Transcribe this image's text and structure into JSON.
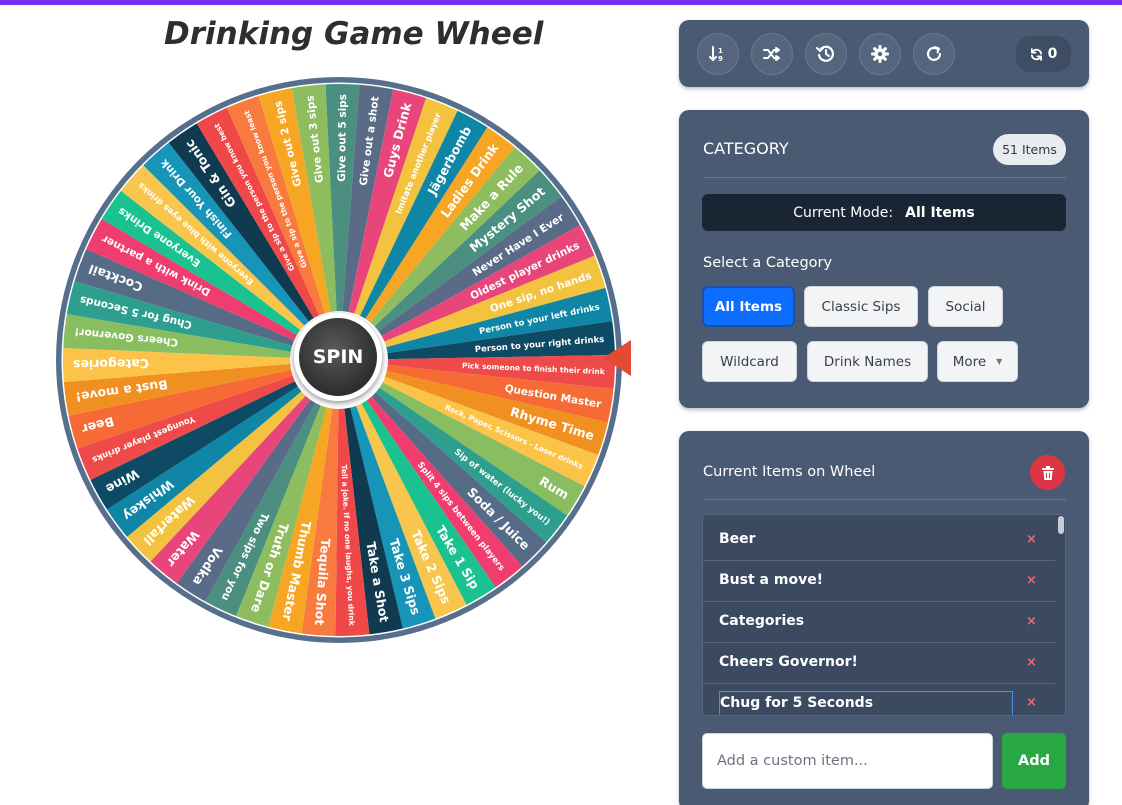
{
  "page": {
    "title": "Drinking Game Wheel"
  },
  "wheel": {
    "spin_label": "SPIN",
    "start_angle_deg": -57.5,
    "segments": [
      "Ladies Drink",
      "Make a Rule",
      "Mystery Shot",
      "Never Have I Ever",
      "Oldest player drinks",
      "One sip, no hands",
      "Person to your left drinks",
      "Person to your right drinks",
      "Pick someone to finish their drink",
      "Question Master",
      "Rhyme Time",
      "Rock, Paper, Scissors - Loser drinks",
      "Rum",
      "Sip of water (lucky you!)",
      "Soda / Juice",
      "Split 4 sips between players",
      "Take 1 Sip",
      "Take 2 Sips",
      "Take 3 Sips",
      "Take a Shot",
      "Tell a joke. If no one laughs, you drink",
      "Tequila Shot",
      "Thumb Master",
      "Truth or Dare",
      "Two sips for you",
      "Vodka",
      "Water",
      "Waterfall",
      "Whiskey",
      "Wine",
      "Youngest player drinks",
      "Beer",
      "Bust a move!",
      "Categories",
      "Cheers Governor!",
      "Chug for 5 Seconds",
      "Cocktail",
      "Drink with a partner",
      "Everyone Drinks",
      "Everyone with blue eyes drinks",
      "Finish Your Drink",
      "Gin & Tonic",
      "Give a sip to the person you know best",
      "Give a sip to the person you know least",
      "Give out 2 sips",
      "Give out 3 sips",
      "Give out 5 sips",
      "Give out a shot",
      "Guys Drink",
      "Imitate another player",
      "Jägerbomb"
    ],
    "palette": [
      "#f7a623",
      "#8ebd5f",
      "#4a8f7f",
      "#596b86",
      "#e8457a",
      "#f3c23e",
      "#0f86a6",
      "#0e4a63",
      "#ee4a4a",
      "#f56a35",
      "#f09020",
      "#fbc448",
      "#88bd60",
      "#2e9f8e",
      "#566c86",
      "#ee3d6e",
      "#19c28e",
      "#f9c64d",
      "#1795b8",
      "#0f3a4f",
      "#f04848",
      "#f97a3f"
    ],
    "colors": {
      "rim": "#566f8c",
      "hub": "#3a3a3a",
      "pointer": "#e24a33"
    }
  },
  "toolbar": {
    "icons": [
      "sort-icon",
      "shuffle-icon",
      "history-icon",
      "settings-icon",
      "reset-icon"
    ],
    "spin_count": "0"
  },
  "category": {
    "heading": "CATEGORY",
    "count_badge": "51 Items",
    "mode_label": "Current Mode:",
    "mode_value": "All Items",
    "select_label": "Select a Category",
    "buttons": [
      "All Items",
      "Classic Sips",
      "Social",
      "Wildcard",
      "Drink Names",
      "More"
    ],
    "active": "All Items"
  },
  "items": {
    "heading": "Current Items on Wheel",
    "list": [
      "Beer",
      "Bust a move!",
      "Categories",
      "Cheers Governor!",
      "Chug for 5 Seconds"
    ],
    "remove_glyph": "×",
    "input_placeholder": "Add a custom item...",
    "add_label": "Add"
  },
  "colors": {
    "panel": "#4a5a73",
    "accent_blue": "#0d6efd",
    "danger": "#dc3545",
    "success": "#28a745",
    "top_bar": "#7a2ff0"
  }
}
